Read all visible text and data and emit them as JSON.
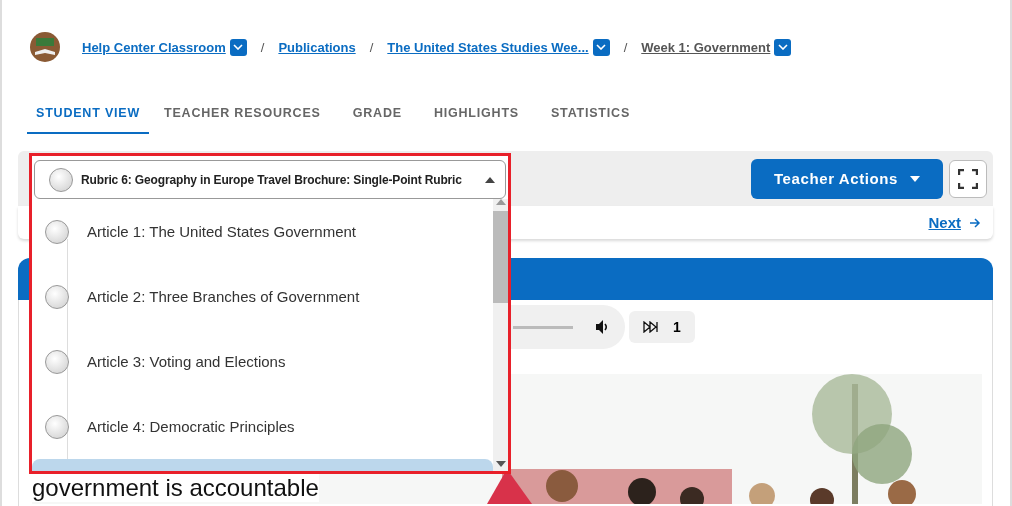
{
  "breadcrumb": [
    {
      "label": "Help Center Classroom",
      "current": false,
      "has_menu": true
    },
    {
      "separator": "/",
      "label": "Publications",
      "current": false,
      "has_menu": false
    },
    {
      "separator": "/",
      "label": "The United States Studies Wee...",
      "current": false,
      "has_menu": true
    },
    {
      "separator": "/",
      "label": "Week 1: Government",
      "current": true,
      "has_menu": true
    }
  ],
  "tabs": [
    {
      "label": "STUDENT VIEW",
      "selected": true
    },
    {
      "label": "TEACHER RESOURCES",
      "selected": false
    },
    {
      "label": "GRADE",
      "selected": false
    },
    {
      "label": "HIGHLIGHTS",
      "selected": false
    },
    {
      "label": "STATISTICS",
      "selected": false
    }
  ],
  "rubric_select": {
    "value": "Rubric 6: Geography in Europe Travel Brochure: Single-Point Rubric",
    "expanded": true
  },
  "options": [
    {
      "label": "Article 1: The United States Government",
      "highlighted": false
    },
    {
      "label": "Article 2: Three Branches of Government",
      "highlighted": false
    },
    {
      "label": "Article 3: Voting and Elections",
      "highlighted": false
    },
    {
      "label": "Article 4: Democratic Principles",
      "highlighted": false
    },
    {
      "highlighted": true
    }
  ],
  "teacher_actions": {
    "label": "Teacher Actions"
  },
  "next_link": {
    "label": "Next"
  },
  "audio": {
    "speed": "1"
  },
  "content": {
    "text": "government is accountable"
  }
}
